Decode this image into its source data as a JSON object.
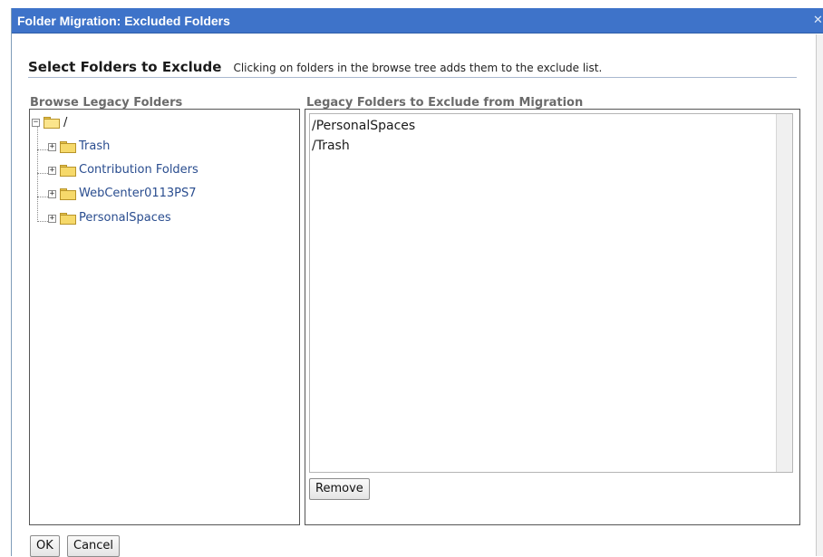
{
  "dialog": {
    "title": "Folder Migration: Excluded Folders",
    "close_glyph": "✕"
  },
  "header": {
    "title": "Select Folders to Exclude",
    "description": "Clicking on folders in the browse tree adds them to the exclude list."
  },
  "browse": {
    "label": "Browse Legacy Folders",
    "root": {
      "label": "/",
      "icon": "folder-open-icon",
      "expander": "−"
    },
    "children": [
      {
        "label": "Trash",
        "icon": "folder-icon",
        "expander": "+"
      },
      {
        "label": "Contribution Folders",
        "icon": "folder-icon",
        "expander": "+"
      },
      {
        "label": "WebCenter0113PS7",
        "icon": "folder-icon",
        "expander": "+"
      },
      {
        "label": "PersonalSpaces",
        "icon": "folder-icon",
        "expander": "+"
      }
    ]
  },
  "exclude": {
    "label": "Legacy Folders to Exclude from Migration",
    "items": [
      "/PersonalSpaces",
      "/Trash"
    ],
    "remove_label": "Remove"
  },
  "footer": {
    "ok_label": "OK",
    "cancel_label": "Cancel"
  },
  "colors": {
    "titlebar": "#3e73c9",
    "link": "#2a4d8f",
    "folder": "#f6d96a"
  }
}
